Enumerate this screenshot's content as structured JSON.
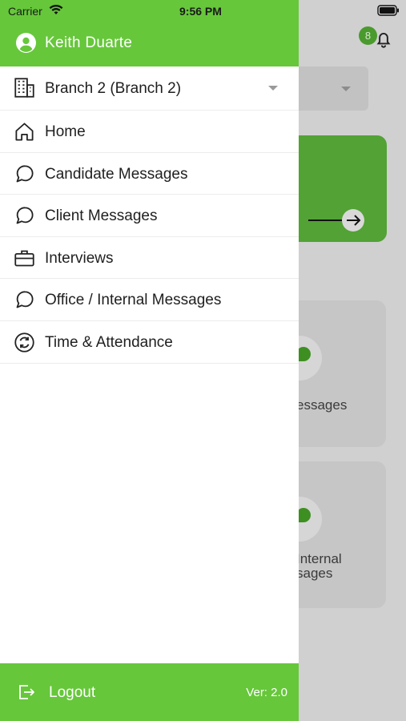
{
  "status_bar": {
    "carrier": "Carrier",
    "time": "9:56 PM"
  },
  "drawer": {
    "user_name": "Keith Duarte",
    "branch": {
      "label": "Branch 2 (Branch 2)"
    },
    "items": [
      {
        "label": "Home",
        "icon": "home-icon"
      },
      {
        "label": "Candidate Messages",
        "icon": "chat-bubble-icon"
      },
      {
        "label": "Client Messages",
        "icon": "chat-bubble-icon"
      },
      {
        "label": "Interviews",
        "icon": "briefcase-icon"
      },
      {
        "label": "Office / Internal Messages",
        "icon": "chat-bubble-icon"
      },
      {
        "label": "Time & Attendance",
        "icon": "clock-cycle-icon"
      }
    ],
    "footer": {
      "logout_label": "Logout",
      "version": "Ver: 2.0"
    }
  },
  "background": {
    "notification_count": "8",
    "card_1_text": "essages",
    "card_2_line1": "Internal",
    "card_2_line2": "sages"
  },
  "colors": {
    "accent": "#66c73a",
    "accent_dim": "#52a235",
    "overlay": "#d0d0d0"
  }
}
